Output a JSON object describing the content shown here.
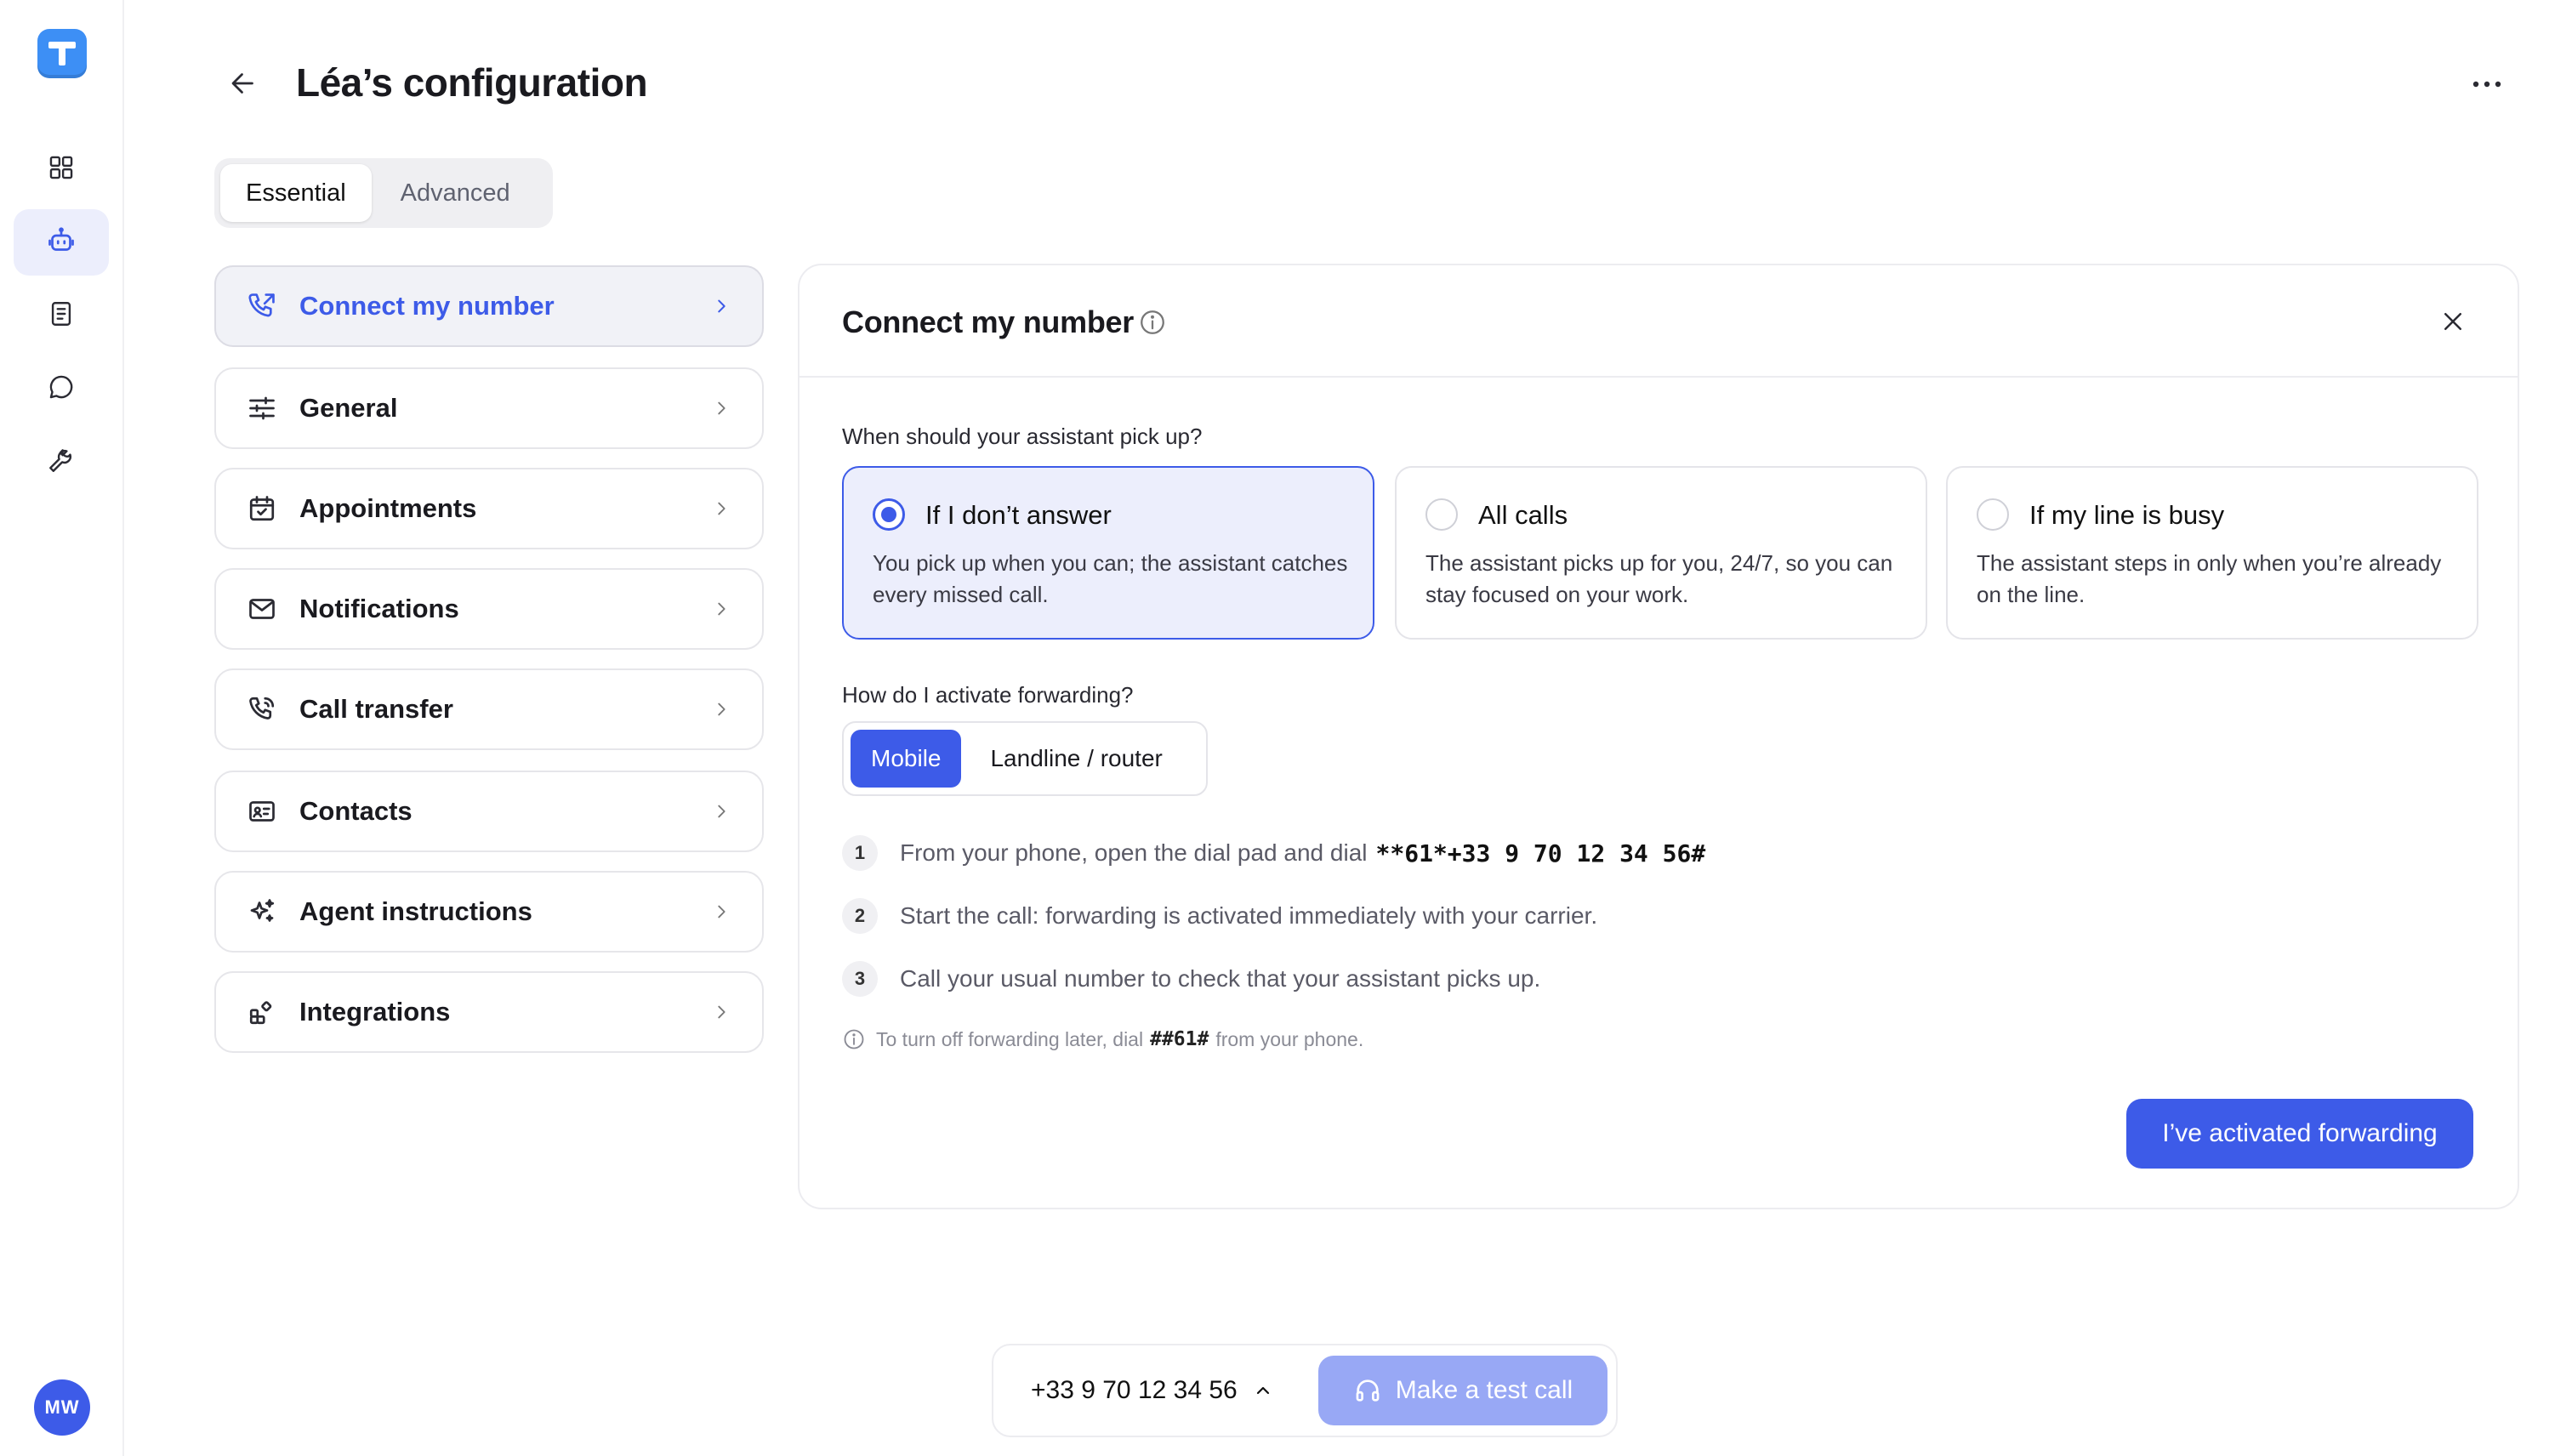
{
  "app": {
    "logo_letter": "T",
    "accent": "#3d5be8",
    "logo_color": "#3d8ff5"
  },
  "rail": {
    "items": [
      {
        "icon": "grid-icon"
      },
      {
        "icon": "robot-icon",
        "active": true
      },
      {
        "icon": "book-icon"
      },
      {
        "icon": "chat-icon"
      },
      {
        "icon": "wrench-icon"
      }
    ],
    "avatar_initials": "MW"
  },
  "header": {
    "title": "Léa’s configuration"
  },
  "tabs": [
    {
      "label": "Essential",
      "selected": true
    },
    {
      "label": "Advanced",
      "selected": false
    }
  ],
  "menu": [
    {
      "label": "Connect my number",
      "icon": "phone-forward-icon",
      "selected": true
    },
    {
      "label": "General",
      "icon": "sliders-icon"
    },
    {
      "label": "Appointments",
      "icon": "calendar-check-icon"
    },
    {
      "label": "Notifications",
      "icon": "mail-icon"
    },
    {
      "label": "Call transfer",
      "icon": "phone-icon"
    },
    {
      "label": "Contacts",
      "icon": "contact-card-icon"
    },
    {
      "label": "Agent instructions",
      "icon": "sparkles-icon"
    },
    {
      "label": "Integrations",
      "icon": "apps-icon"
    }
  ],
  "panel": {
    "title": "Connect my number",
    "question_pickup": "When should your assistant pick up?",
    "options": [
      {
        "title": "If I don’t answer",
        "desc": "You pick up when you can; the assistant catches every missed call.",
        "selected": true
      },
      {
        "title": "All calls",
        "desc": "The assistant picks up for you, 24/7, so you can stay focused on your work.",
        "selected": false
      },
      {
        "title": "If my line is busy",
        "desc": "The assistant steps in only when you’re already on the line.",
        "selected": false
      }
    ],
    "question_forwarding": "How do I activate forwarding?",
    "segments": [
      {
        "label": "Mobile",
        "selected": true
      },
      {
        "label": "Landline / router",
        "selected": false
      }
    ],
    "steps": [
      {
        "num": "1",
        "text": "From your phone, open the dial pad and dial",
        "code": "**61*+33 9 70 12 34 56#"
      },
      {
        "num": "2",
        "text": "Start the call: forwarding is activated immediately with your carrier.",
        "code": ""
      },
      {
        "num": "3",
        "text": "Call your usual number to check that your assistant picks up.",
        "code": ""
      }
    ],
    "note": {
      "before": "To turn off forwarding later, dial",
      "code": "##61#",
      "after": "from your phone."
    },
    "confirm_label": "I’ve activated forwarding"
  },
  "bottom_bar": {
    "phone_number": "+33 9 70 12 34 56",
    "test_call_label": "Make a test call"
  }
}
